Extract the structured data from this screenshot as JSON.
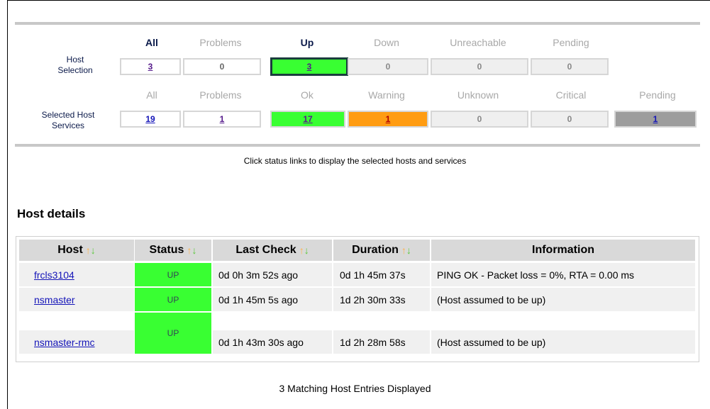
{
  "host_summary": {
    "headers": [
      {
        "label": "All",
        "active": true
      },
      {
        "label": "Problems",
        "active": false
      },
      {
        "label": "Up",
        "active": true
      },
      {
        "label": "Down",
        "active": false
      },
      {
        "label": "Unreachable",
        "active": false
      },
      {
        "label": "Pending",
        "active": false
      }
    ],
    "row_label": "Host\nSelection",
    "values": [
      "3",
      "0",
      "3",
      "0",
      "0",
      "0"
    ]
  },
  "service_summary": {
    "headers": [
      "All",
      "Problems",
      "Ok",
      "Warning",
      "Unknown",
      "Critical",
      "Pending"
    ],
    "row_label": "Selected Host\nServices",
    "values": [
      "19",
      "1",
      "17",
      "1",
      "0",
      "0",
      "1"
    ]
  },
  "hint_text": "Click status links to display the selected hosts and services",
  "section_title": "Host details",
  "host_table": {
    "columns": [
      "Host",
      "Status",
      "Last Check",
      "Duration",
      "Information"
    ],
    "rows": [
      {
        "host": "frcls3104",
        "status": "UP",
        "last_check": "0d 0h 3m 52s ago",
        "duration": "0d 1h 45m 37s",
        "information": "PING OK - Packet loss = 0%, RTA = 0.00 ms"
      },
      {
        "host": "nsmaster",
        "status": "UP",
        "last_check": "0d 1h 45m 5s ago",
        "duration": "1d 2h 30m 33s",
        "information": "(Host assumed to be up)"
      },
      {
        "host": "nsmaster-rmc",
        "status": "UP",
        "last_check": "0d 1h 43m 30s ago",
        "duration": "1d 2h 28m 58s",
        "information": "(Host assumed to be up)"
      }
    ]
  },
  "footer_text": "3 Matching Host Entries Displayed",
  "colors": {
    "up_green": "#39ff32",
    "warning_orange": "#ff9c12",
    "pending_gray": "#9d9d9d",
    "header_gray": "#d9d9d9",
    "row_gray": "#f0f0f0"
  },
  "icons": {
    "sort_up": "sort-ascending-icon",
    "sort_down": "sort-descending-icon"
  }
}
